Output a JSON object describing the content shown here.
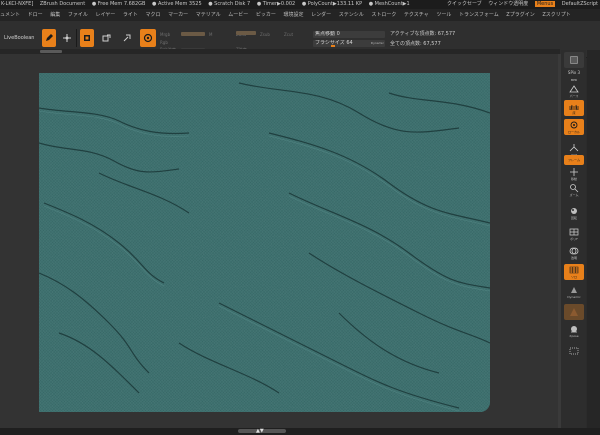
{
  "titlebar": {
    "left": [
      "K-LKCI-NXFE]",
      "ZBrush Document",
      "● Free Mem 7.682GB",
      "● Active Mem 3525",
      "● Scratch Disk 7",
      "● Timer▶0.002",
      "● PolyCount▶133.11 KP",
      "● MeshCount▶1"
    ],
    "quicksave": "クイックセーブ",
    "transparency": "ウィンドウ透明度",
    "menus": "Menus",
    "default_script": "DefaultZScript",
    "accent_color": "#e8801a"
  },
  "menubar": {
    "items": [
      "ュメント",
      "ドロー",
      "編集",
      "ファイル",
      "レイヤー",
      "ライト",
      "マクロ",
      "マーカー",
      "マテリアル",
      "ムービー",
      "ピッカー",
      "環境設定",
      "レンダー",
      "ステンシル",
      "ストローク",
      "テクスチャ",
      "ツール",
      "トランスフォーム",
      "Zプラグイン",
      "Zスクリプト"
    ]
  },
  "toolbar": {
    "livebool": "LiveBoolean",
    "buttons": [
      {
        "name": "edit-button",
        "icon": "edit-icon",
        "active": true
      },
      {
        "name": "draw-button",
        "icon": "draw-icon",
        "active": false
      },
      {
        "name": "move-button",
        "icon": "move-icon",
        "active": true
      },
      {
        "name": "scale-button",
        "icon": "scale-icon",
        "active": false
      },
      {
        "name": "rotate-button",
        "icon": "rotate-icon",
        "active": true
      }
    ],
    "dim": {
      "mrgb": "Mrgb",
      "rgb": "Rgb",
      "m": "M",
      "zadd": "Zadd",
      "zsub": "Zsub",
      "zcut": "Zcut",
      "rgb_intensity": "Rgb強度",
      "z_intensity": "Z強度"
    },
    "focal_shift": {
      "label": "焦点移動",
      "value": "0"
    },
    "draw_size": {
      "label": "ブラシサイズ",
      "value": "64",
      "tag": "Dynamic"
    },
    "active_points": "アクティブな頂点数: 67,577",
    "total_points": "全ての頂点数: 67,577"
  },
  "right_shelf": {
    "spix": "SPix 3",
    "bpr": "BPR",
    "items": [
      {
        "name": "perspective-button",
        "label": "パース",
        "active": false
      },
      {
        "name": "floor-button",
        "label": "床",
        "active": true
      },
      {
        "name": "local-button",
        "label": "ローカル",
        "active": true
      },
      {
        "name": "xyz-button",
        "label": "XYZ",
        "active": false
      },
      {
        "name": "frame-button",
        "label": "フレーム",
        "active": false
      },
      {
        "name": "move-view-button",
        "label": "移動",
        "active": false
      },
      {
        "name": "zoom-view-button",
        "label": "ズーム",
        "active": false
      },
      {
        "name": "rotate-view-button",
        "label": "回転",
        "active": false
      },
      {
        "name": "polyframe-button",
        "label": "ポリF",
        "active": true
      },
      {
        "name": "transp-button",
        "label": "透明",
        "active": false
      },
      {
        "name": "solo-button",
        "label": "ソロ",
        "active": true
      },
      {
        "name": "dynamic-button",
        "label": "Dynamic",
        "active": false
      },
      {
        "name": "xpose-button",
        "label": "Xpose",
        "active": false
      }
    ]
  },
  "canvas": {
    "texture_color": "#3f7270",
    "ridge_color": "#1d3b3b"
  },
  "bottom": {
    "handle_label": "▲▼"
  }
}
